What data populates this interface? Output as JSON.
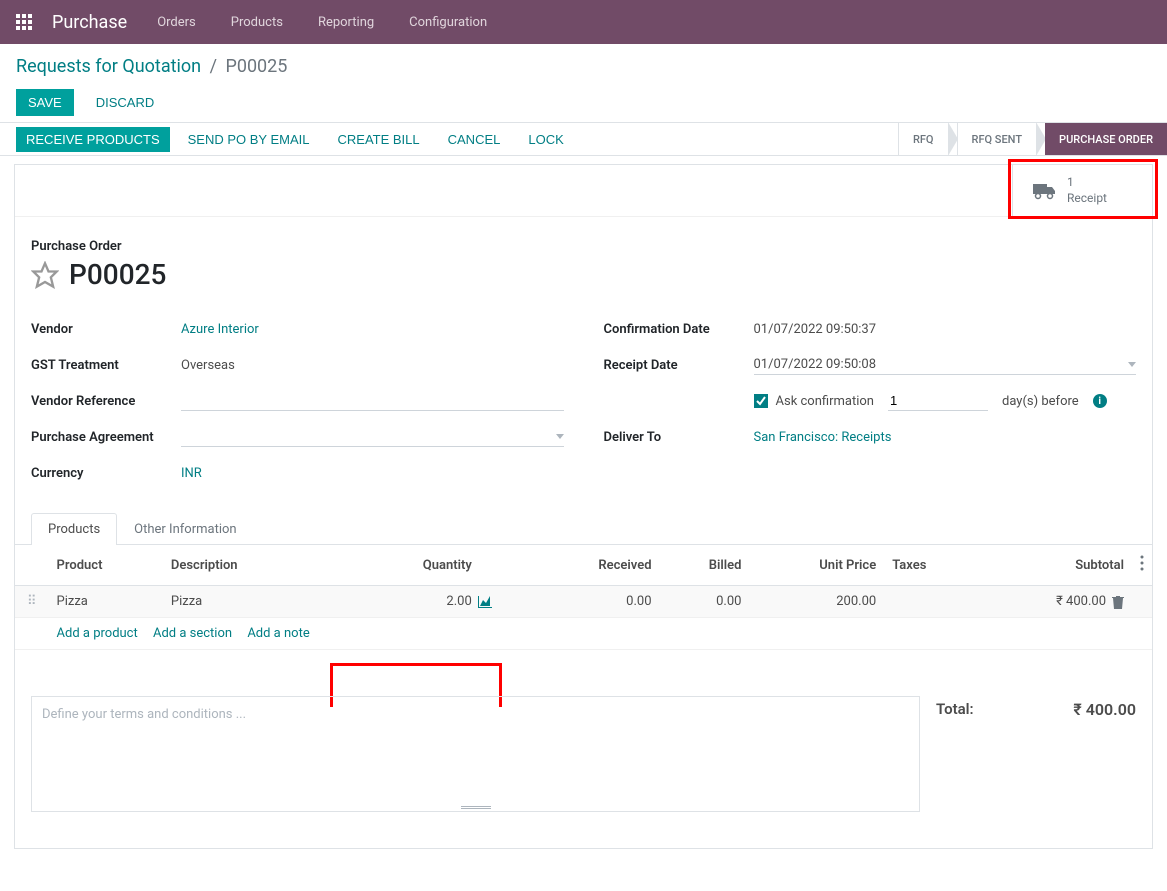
{
  "navbar": {
    "brand": "Purchase",
    "items": [
      "Orders",
      "Products",
      "Reporting",
      "Configuration"
    ]
  },
  "breadcrumb": {
    "parent": "Requests for Quotation",
    "current": "P00025"
  },
  "controls": {
    "save": "Save",
    "discard": "Discard"
  },
  "statusbar": {
    "buttons": [
      "Receive Products",
      "Send PO by Email",
      "Create Bill",
      "Cancel",
      "Lock"
    ],
    "stages": [
      {
        "label": "RFQ",
        "active": false
      },
      {
        "label": "RFQ Sent",
        "active": false
      },
      {
        "label": "Purchase Order",
        "active": true
      }
    ]
  },
  "stat_button": {
    "count": "1",
    "label": "Receipt"
  },
  "title": {
    "label": "Purchase Order",
    "name": "P00025"
  },
  "fields": {
    "left": {
      "vendor_label": "Vendor",
      "vendor_value": "Azure Interior",
      "gst_label": "GST Treatment",
      "gst_value": "Overseas",
      "vref_label": "Vendor Reference",
      "vref_value": "",
      "agreement_label": "Purchase Agreement",
      "agreement_value": "",
      "currency_label": "Currency",
      "currency_value": "INR"
    },
    "right": {
      "confirm_label": "Confirmation Date",
      "confirm_value": "01/07/2022 09:50:37",
      "receipt_label": "Receipt Date",
      "receipt_value": "01/07/2022 09:50:08",
      "ask_confirm_label": "Ask confirmation",
      "days_value": "1",
      "days_suffix": "day(s) before",
      "deliver_label": "Deliver To",
      "deliver_value": "San Francisco: Receipts"
    }
  },
  "tabs": {
    "products": "Products",
    "other": "Other Information"
  },
  "table": {
    "headers": {
      "product": "Product",
      "description": "Description",
      "quantity": "Quantity",
      "received": "Received",
      "billed": "Billed",
      "unit_price": "Unit Price",
      "taxes": "Taxes",
      "subtotal": "Subtotal"
    },
    "rows": [
      {
        "product": "Pizza",
        "description": "Pizza",
        "quantity": "2.00",
        "received": "0.00",
        "billed": "0.00",
        "unit_price": "200.00",
        "taxes": "",
        "subtotal": "₹ 400.00"
      }
    ],
    "add": {
      "product": "Add a product",
      "section": "Add a section",
      "note": "Add a note"
    }
  },
  "terms_placeholder": "Define your terms and conditions ...",
  "totals": {
    "total_label": "Total:",
    "total_value": "₹ 400.00"
  }
}
